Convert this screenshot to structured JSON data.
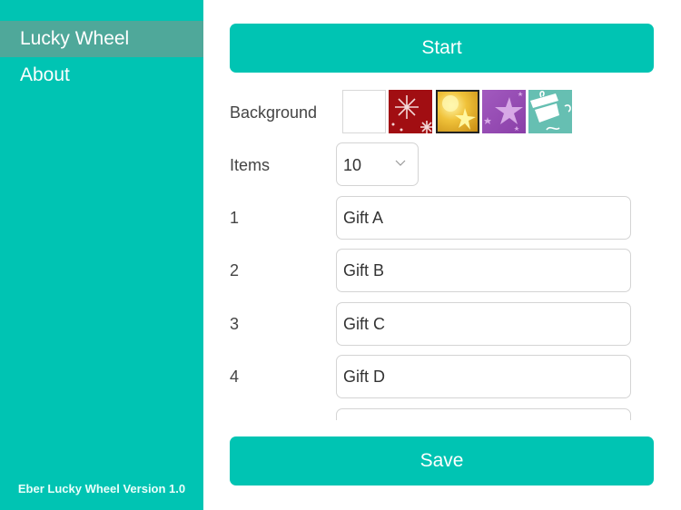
{
  "sidebar": {
    "items": [
      {
        "label": "Lucky Wheel",
        "active": true
      },
      {
        "label": "About",
        "active": false
      }
    ],
    "version": "Eber Lucky Wheel Version 1.0"
  },
  "main": {
    "start_label": "Start",
    "save_label": "Save",
    "background_label": "Background",
    "backgrounds": [
      {
        "name": "white"
      },
      {
        "name": "red-snowflakes"
      },
      {
        "name": "gold-sparkle",
        "selected": true
      },
      {
        "name": "purple-stars"
      },
      {
        "name": "teal-gifts"
      }
    ],
    "items_label": "Items",
    "items_count": "10",
    "rows": [
      {
        "num": "1",
        "value": "Gift A"
      },
      {
        "num": "2",
        "value": "Gift B"
      },
      {
        "num": "3",
        "value": "Gift C"
      },
      {
        "num": "4",
        "value": "Gift D"
      },
      {
        "num": "",
        "value": ""
      }
    ]
  },
  "colors": {
    "accent": "#00c4b3",
    "active_nav": "#4fa89a"
  }
}
